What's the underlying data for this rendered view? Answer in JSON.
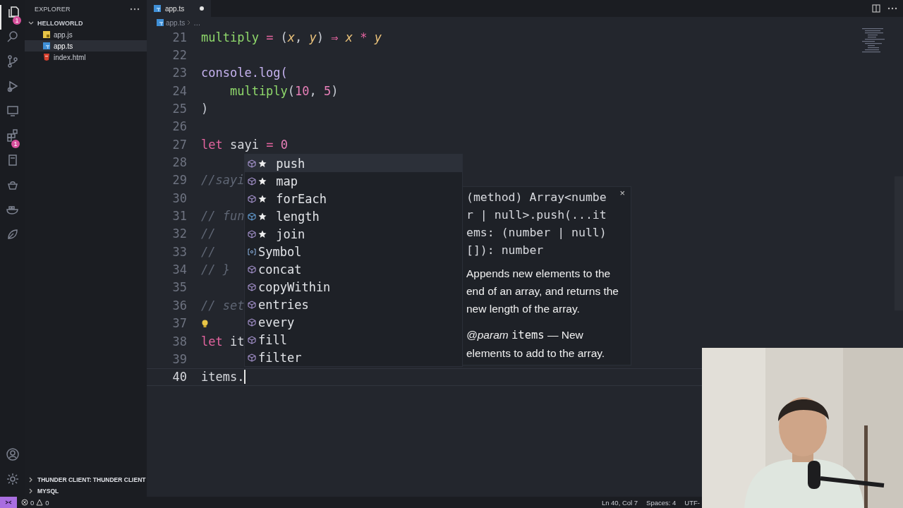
{
  "activity_bar": {
    "items": [
      {
        "kind": "files",
        "badge": "1",
        "selected": true
      },
      {
        "kind": "search",
        "selected": false
      },
      {
        "kind": "branch",
        "selected": false
      },
      {
        "kind": "run",
        "selected": false
      },
      {
        "kind": "monitor",
        "selected": false
      },
      {
        "kind": "extensions",
        "badge": "1",
        "selected": false
      },
      {
        "kind": "page",
        "selected": false
      },
      {
        "kind": "pot",
        "selected": false
      },
      {
        "kind": "whale",
        "selected": false
      },
      {
        "kind": "leaf",
        "selected": false
      }
    ],
    "bottom": [
      {
        "kind": "account"
      },
      {
        "kind": "settings"
      }
    ]
  },
  "sidebar": {
    "title": "EXPLORER",
    "folder": {
      "name": "HELLOWORLD",
      "expanded": true,
      "files": [
        {
          "name": "app.js",
          "kind": "js",
          "selected": false
        },
        {
          "name": "app.ts",
          "kind": "ts",
          "selected": true
        },
        {
          "name": "index.html",
          "kind": "html",
          "selected": false
        }
      ]
    },
    "sections": [
      {
        "name": "THUNDER CLIENT: THUNDER CLIENT",
        "expanded": false
      },
      {
        "name": "MYSQL",
        "expanded": false
      }
    ]
  },
  "editor": {
    "tabs": [
      {
        "label": "app.ts",
        "kind": "ts",
        "modified": true,
        "selected": true
      }
    ],
    "breadcrumb": [
      "app.ts",
      "…"
    ],
    "lines": [
      {
        "number": "21",
        "current": false,
        "lightbulb": false,
        "tokens": [
          {
            "kind": "fn",
            "text": "multiply"
          },
          {
            "kind": "op",
            "text": " = "
          },
          {
            "kind": "punc",
            "text": "("
          },
          {
            "kind": "param",
            "text": "x"
          },
          {
            "kind": "punc",
            "text": ", "
          },
          {
            "kind": "param",
            "text": "y"
          },
          {
            "kind": "punc",
            "text": ") "
          },
          {
            "kind": "op",
            "text": "⇒ "
          },
          {
            "kind": "param",
            "text": "x"
          },
          {
            "kind": "op",
            "text": " * "
          },
          {
            "kind": "param",
            "text": "y"
          }
        ]
      },
      {
        "number": "22",
        "current": false,
        "lightbulb": false
      },
      {
        "number": "23",
        "current": false,
        "lightbulb": false,
        "tokens": [
          {
            "kind": "call",
            "text": "console.log("
          }
        ]
      },
      {
        "number": "24",
        "current": false,
        "lightbulb": false,
        "tokens": [
          {
            "kind": "fn",
            "text": "    multiply"
          },
          {
            "kind": "punc",
            "text": "("
          },
          {
            "kind": "num",
            "text": "10"
          },
          {
            "kind": "punc",
            "text": ", "
          },
          {
            "kind": "num",
            "text": "5"
          },
          {
            "kind": "punc",
            "text": ")"
          }
        ]
      },
      {
        "number": "25",
        "current": false,
        "lightbulb": false,
        "tokens": [
          {
            "kind": "punc",
            "text": ")"
          }
        ]
      },
      {
        "number": "26",
        "current": false,
        "lightbulb": false
      },
      {
        "number": "27",
        "current": false,
        "lightbulb": false,
        "tokens": [
          {
            "kind": "kw",
            "text": "let"
          },
          {
            "kind": "plain",
            "text": " sayi "
          },
          {
            "kind": "op",
            "text": "= "
          },
          {
            "kind": "num",
            "text": "0"
          }
        ]
      },
      {
        "number": "28",
        "current": false,
        "lightbulb": false
      },
      {
        "number": "29",
        "current": false,
        "lightbulb": false,
        "tokens": [
          {
            "kind": "cmt",
            "text": "//sayi"
          }
        ]
      },
      {
        "number": "30",
        "current": false,
        "lightbulb": false
      },
      {
        "number": "31",
        "current": false,
        "lightbulb": false,
        "tokens": [
          {
            "kind": "cmt",
            "text": "// fun"
          }
        ]
      },
      {
        "number": "32",
        "current": false,
        "lightbulb": false,
        "tokens": [
          {
            "kind": "cmt",
            "text": "//"
          }
        ]
      },
      {
        "number": "33",
        "current": false,
        "lightbulb": false,
        "tokens": [
          {
            "kind": "cmt",
            "text": "//"
          }
        ]
      },
      {
        "number": "34",
        "current": false,
        "lightbulb": false,
        "tokens": [
          {
            "kind": "cmt",
            "text": "// }"
          }
        ]
      },
      {
        "number": "35",
        "current": false,
        "lightbulb": false
      },
      {
        "number": "36",
        "current": false,
        "lightbulb": false,
        "tokens": [
          {
            "kind": "cmt",
            "text": "// set"
          }
        ]
      },
      {
        "number": "37",
        "current": false,
        "lightbulb": true
      },
      {
        "number": "38",
        "current": false,
        "lightbulb": false,
        "tokens": [
          {
            "kind": "kw",
            "text": "let"
          },
          {
            "kind": "plain",
            "text": " it"
          }
        ]
      },
      {
        "number": "39",
        "current": false,
        "lightbulb": false
      },
      {
        "number": "40",
        "current": true,
        "lightbulb": false,
        "tokens": [
          {
            "kind": "plain",
            "text": "items."
          }
        ]
      }
    ],
    "suggestions": [
      {
        "label": "push",
        "starred": true,
        "kind": "method",
        "selected": true
      },
      {
        "label": "map",
        "starred": true,
        "kind": "method",
        "selected": false
      },
      {
        "label": "forEach",
        "starred": true,
        "kind": "method",
        "selected": false
      },
      {
        "label": "length",
        "starred": true,
        "kind": "property",
        "selected": false
      },
      {
        "label": "join",
        "starred": true,
        "kind": "method",
        "selected": false
      },
      {
        "label": "Symbol",
        "starred": false,
        "kind": "variable",
        "selected": false
      },
      {
        "label": "concat",
        "starred": false,
        "kind": "method",
        "selected": false
      },
      {
        "label": "copyWithin",
        "starred": false,
        "kind": "method",
        "selected": false
      },
      {
        "label": "entries",
        "starred": false,
        "kind": "method",
        "selected": false
      },
      {
        "label": "every",
        "starred": false,
        "kind": "method",
        "selected": false
      },
      {
        "label": "fill",
        "starred": false,
        "kind": "method",
        "selected": false
      },
      {
        "label": "filter",
        "starred": false,
        "kind": "method",
        "selected": false
      }
    ],
    "details": {
      "signature": "(method) Array<number | null>.push(...items: (number | null)[]): number",
      "close": "×",
      "doc": "Appends new elements to the end of an array, and returns the new length of the array.",
      "param": {
        "tag": "@param",
        "name": "items",
        "text": "— New elements to add to the array."
      }
    }
  },
  "status_bar": {
    "errors": "0",
    "warnings": "0",
    "items": [
      "Ln 40, Col 7",
      "Spaces: 4",
      "UTF-"
    ]
  }
}
